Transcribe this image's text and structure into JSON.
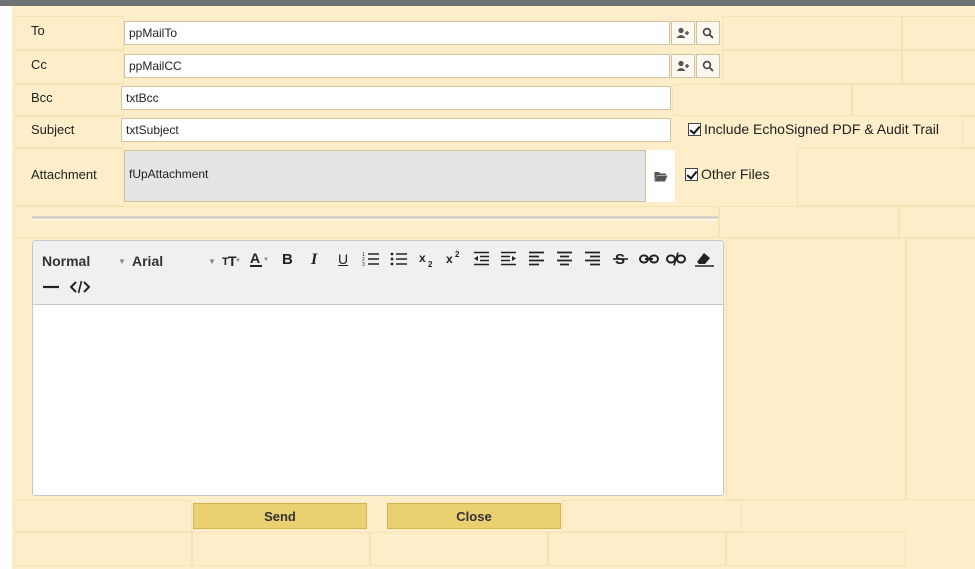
{
  "fields": {
    "to": {
      "label": "To",
      "value": "ppMailTo"
    },
    "cc": {
      "label": "Cc",
      "value": "ppMailCC"
    },
    "bcc": {
      "label": "Bcc",
      "value": "txtBcc"
    },
    "subject": {
      "label": "Subject",
      "value": "txtSubject"
    },
    "attachment": {
      "label": "Attachment",
      "value": "fUpAttachment"
    }
  },
  "checkboxes": {
    "include_echosigned": {
      "label": "Include EchoSigned PDF & Audit Trail",
      "checked": true
    },
    "other_files": {
      "label": "Other Files",
      "checked": true
    }
  },
  "toolbar": {
    "format_select": "Normal",
    "font_select": "Arial",
    "buttons": [
      "text-size",
      "font-color",
      "bold",
      "italic",
      "underline",
      "ordered-list",
      "unordered-list",
      "subscript",
      "superscript",
      "outdent",
      "indent",
      "align-left",
      "align-center",
      "align-right",
      "strikethrough",
      "link",
      "unlink",
      "clear-format",
      "horizontal-rule",
      "source-code"
    ],
    "bold_glyph": "B",
    "italic_glyph": "I",
    "underline_glyph": "U"
  },
  "actions": {
    "send": "Send",
    "close": "Close"
  },
  "colors": {
    "accent": "#ead070",
    "panel": "#fdeec9",
    "topbar": "#6f7272"
  }
}
